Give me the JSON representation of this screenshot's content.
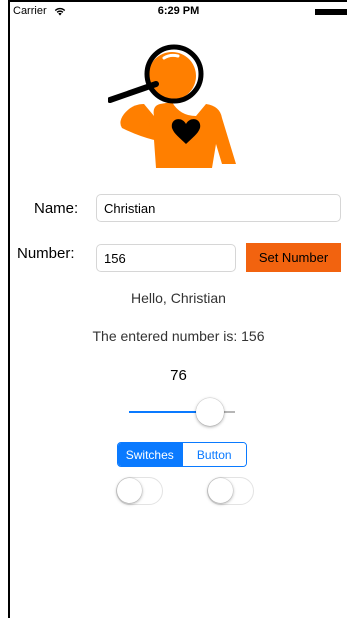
{
  "status_bar": {
    "carrier": "Carrier",
    "time": "6:29 PM"
  },
  "colors": {
    "accent_blue": "#0a7aff",
    "button_orange": "#f2630f",
    "figure_orange": "#ff7f00"
  },
  "form": {
    "name_label": "Name:",
    "name_value": "Christian",
    "number_label": "Number:",
    "number_value": "156",
    "set_number_button": "Set Number"
  },
  "output": {
    "greeting": "Hello, Christian",
    "entered_number": "The entered number is: 156"
  },
  "slider": {
    "value_label": "76",
    "value": 0.76
  },
  "segmented_control": {
    "segments": [
      "Switches",
      "Button"
    ],
    "selected_index": 0
  },
  "switches": [
    {
      "name": "switch-left",
      "on": false
    },
    {
      "name": "switch-right",
      "on": false
    }
  ]
}
